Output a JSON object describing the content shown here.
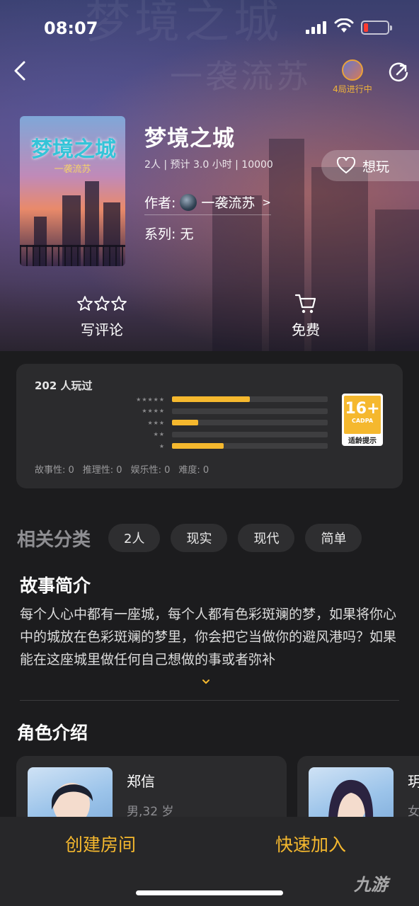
{
  "status_bar": {
    "time": "08:07"
  },
  "header": {
    "room_status": "4局进行中"
  },
  "cover": {
    "title": "梦境之城",
    "subtitle": "一袭流苏"
  },
  "game": {
    "title": "梦境之城",
    "meta": "2人 | 预计 3.0 小时 | 10000",
    "want_label": "想玩",
    "author_label": "作者:",
    "author_name": "一袭流苏",
    "author_chevron": ">",
    "series": "系列: 无"
  },
  "actions": {
    "review": "写评论",
    "price": "免费"
  },
  "rating": {
    "played": "202 人玩过",
    "distribution": [
      {
        "stars": 5,
        "fraction": 0.5
      },
      {
        "stars": 4,
        "fraction": 0.0
      },
      {
        "stars": 3,
        "fraction": 0.17
      },
      {
        "stars": 2,
        "fraction": 0.0
      },
      {
        "stars": 1,
        "fraction": 0.33
      }
    ],
    "age": {
      "rating": "16+",
      "org": "CADPA",
      "caption": "适龄提示"
    },
    "scores": [
      "故事性: 0",
      "推理性: 0",
      "娱乐性: 0",
      "难度: 0"
    ]
  },
  "categories": {
    "label": "相关分类",
    "tags": [
      "2人",
      "现实",
      "现代",
      "简单"
    ]
  },
  "story": {
    "title": "故事简介",
    "text": "每个人心中都有一座城，每个人都有色彩斑斓的梦，如果将你心中的城放在色彩斑斓的梦里，你会把它当做你的避风港吗？如果能在这座城里做任何自己想做的事或者弥补",
    "expand_icon": "chevron-down-icon"
  },
  "characters": {
    "title": "角色介绍",
    "items": [
      {
        "name": "郑信",
        "info": "男,32 岁"
      },
      {
        "name": "玥",
        "info": "女"
      }
    ]
  },
  "bottom": {
    "create_room": "创建房间",
    "quick_join": "快速加入"
  },
  "watermark": "九游",
  "colors": {
    "accent": "#f5b82e",
    "background": "#1c1c1e",
    "card": "#2b2b2d",
    "battery_low": "#ff3b30"
  }
}
